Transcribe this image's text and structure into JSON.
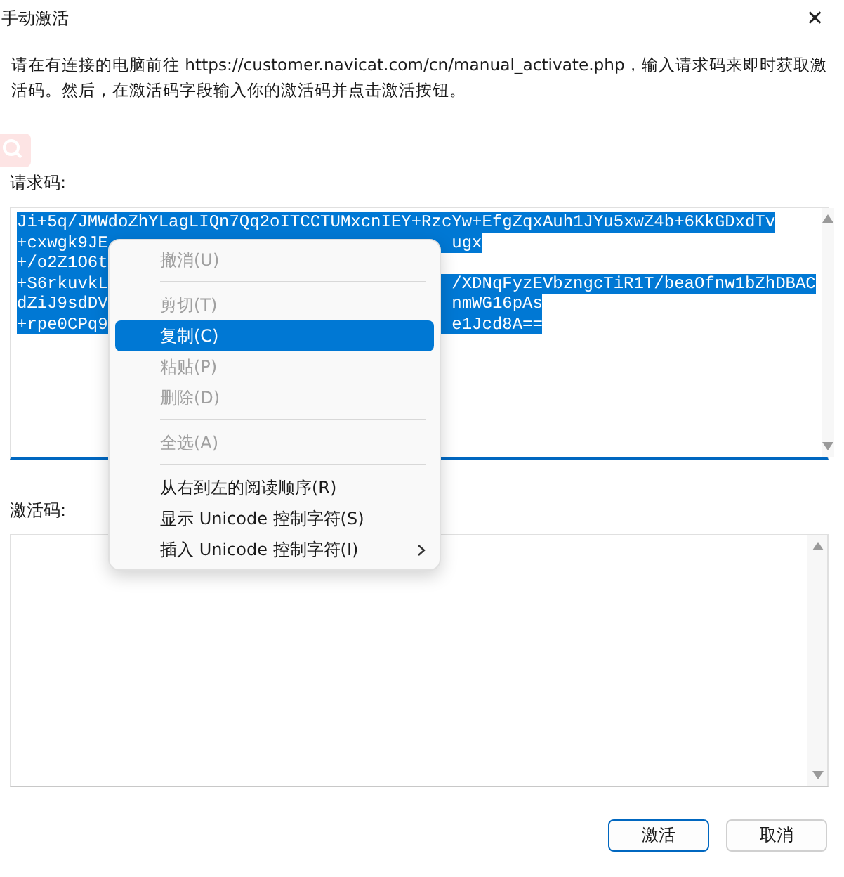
{
  "window": {
    "title": "手动激活",
    "close": "✕"
  },
  "description": "请在有连接的电脑前往 https://customer.navicat.com/cn/manual_activate.php，输入请求码来即时获取激活码。然后，在激活码字段输入你的激活码并点击激活按钮。",
  "request_code": {
    "label": "请求码:",
    "focused": true,
    "lines": [
      {
        "left": "Ji+5q/JMWdoZhYLagLIQn7Qq2oITCCTUMxcnIEY+RzcYw+EfgZqxAuh1JYu5xwZ4b+6KkGDxdTv"
      },
      {
        "left": "+cxwgk9JE",
        "right": "ugx"
      },
      {
        "left": "+/o2Z1O6t"
      },
      {
        "left": "+S6rkuvkL",
        "right": "/XDNqFyzEVbzngcTiR1T/beaOfnw1bZhDBAC"
      },
      {
        "left": "dZiJ9sdDV",
        "right": "nmWG16pAs"
      },
      {
        "left": "+rpe0CPq9",
        "right": "e1Jcd8A=="
      }
    ]
  },
  "activation_code": {
    "label": "激活码:",
    "focused": false
  },
  "buttons": [
    {
      "label": "激活",
      "default": true
    },
    {
      "label": "取消",
      "default": false
    }
  ],
  "context_menu": [
    {
      "kind": "item",
      "label": "撤消(U)",
      "disabled": true,
      "selected": false
    },
    {
      "kind": "separator"
    },
    {
      "kind": "item",
      "label": "剪切(T)",
      "disabled": true,
      "selected": false
    },
    {
      "kind": "item",
      "label": "复制(C)",
      "disabled": false,
      "selected": true
    },
    {
      "kind": "item",
      "label": "粘贴(P)",
      "disabled": true,
      "selected": false
    },
    {
      "kind": "item",
      "label": "删除(D)",
      "disabled": true,
      "selected": false
    },
    {
      "kind": "separator"
    },
    {
      "kind": "item",
      "label": "全选(A)",
      "disabled": true,
      "selected": false
    },
    {
      "kind": "separator"
    },
    {
      "kind": "item",
      "label": "从右到左的阅读顺序(R)",
      "disabled": false,
      "selected": false
    },
    {
      "kind": "item",
      "label": "显示 Unicode 控制字符(S)",
      "disabled": false,
      "selected": false
    },
    {
      "kind": "item",
      "label": "插入 Unicode 控制字符(I)",
      "disabled": false,
      "selected": false,
      "submenu": true
    }
  ]
}
